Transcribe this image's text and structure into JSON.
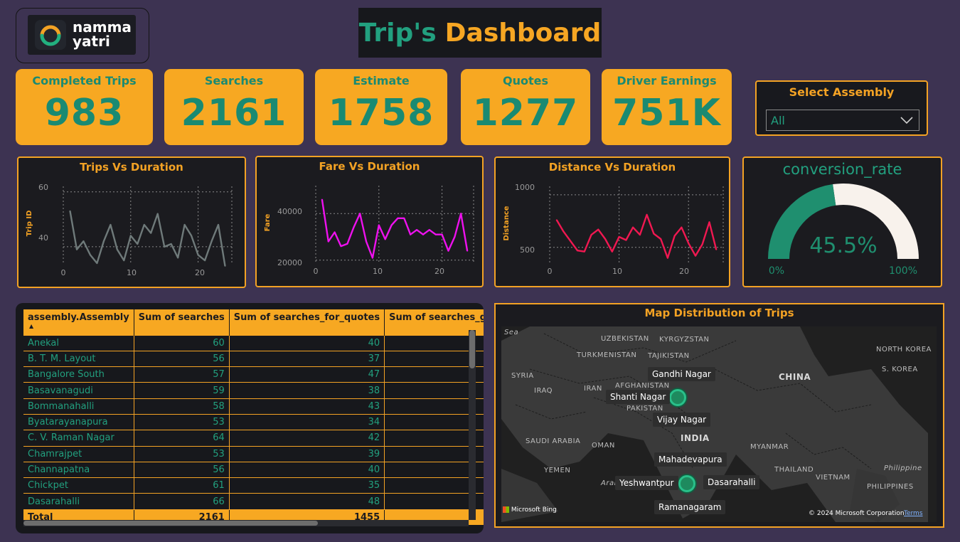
{
  "logo": {
    "line1": "namma",
    "line2": "yatri"
  },
  "title": {
    "part1": "Trip's",
    "part2": "Dashboard"
  },
  "kpis": [
    {
      "label": "Completed Trips",
      "value": "983"
    },
    {
      "label": "Searches",
      "value": "2161"
    },
    {
      "label": "Estimate",
      "value": "1758"
    },
    {
      "label": "Quotes",
      "value": "1277"
    },
    {
      "label": "Driver Earnings",
      "value": "751K"
    }
  ],
  "slicer": {
    "title": "Select Assembly",
    "selected": "All"
  },
  "charts": {
    "trips": {
      "title": "Trips Vs Duration",
      "ylabel": "Trip ID",
      "yticks": [
        "60",
        "40"
      ],
      "xticks": [
        "0",
        "10",
        "20"
      ]
    },
    "fare": {
      "title": "Fare Vs Duration",
      "ylabel": "Fare",
      "yticks": [
        "40000",
        "20000"
      ],
      "xticks": [
        "0",
        "10",
        "20"
      ]
    },
    "distance": {
      "title": "Distance Vs Duration",
      "ylabel": "Distance",
      "yticks": [
        "1000",
        "500"
      ],
      "xticks": [
        "0",
        "10",
        "20"
      ]
    }
  },
  "chart_data": [
    {
      "type": "line",
      "title": "Trips Vs Duration",
      "ylabel": "Trip ID",
      "xlim": [
        0,
        25
      ],
      "ylim": [
        34,
        62
      ],
      "color": "#6f7a7a",
      "x": [
        1,
        2,
        3,
        4,
        5,
        6,
        7,
        8,
        9,
        10,
        11,
        12,
        13,
        14,
        15,
        16,
        17,
        18,
        19,
        20,
        21,
        22,
        23,
        24
      ],
      "y": [
        53,
        39,
        42,
        37,
        34,
        42,
        48,
        39,
        35,
        44,
        41,
        48,
        45,
        52,
        40,
        41,
        36,
        48,
        44,
        37,
        35,
        42,
        48,
        33
      ]
    },
    {
      "type": "line",
      "title": "Fare Vs Duration",
      "ylabel": "Fare",
      "xlim": [
        0,
        25
      ],
      "ylim": [
        19000,
        52000
      ],
      "color": "#ee11ee",
      "x": [
        1,
        2,
        3,
        4,
        5,
        6,
        7,
        8,
        9,
        10,
        11,
        12,
        13,
        14,
        15,
        16,
        17,
        18,
        19,
        20,
        21,
        22,
        23,
        24
      ],
      "y": [
        46000,
        28000,
        32000,
        26000,
        27000,
        34000,
        40000,
        28000,
        21000,
        35000,
        29000,
        35000,
        38000,
        38000,
        31000,
        33000,
        31000,
        33000,
        31000,
        31000,
        24000,
        30000,
        40000,
        24000
      ]
    },
    {
      "type": "line",
      "title": "Distance Vs Duration",
      "ylabel": "Distance",
      "xlim": [
        0,
        25
      ],
      "ylim": [
        350,
        1080
      ],
      "color": "#f01851",
      "x": [
        1,
        2,
        3,
        4,
        5,
        6,
        7,
        8,
        9,
        10,
        11,
        12,
        13,
        14,
        15,
        16,
        17,
        18,
        19,
        20,
        21,
        22,
        23,
        24
      ],
      "y": [
        760,
        650,
        560,
        470,
        460,
        620,
        670,
        580,
        460,
        600,
        570,
        690,
        620,
        810,
        630,
        580,
        400,
        610,
        690,
        540,
        420,
        530,
        740,
        480
      ]
    }
  ],
  "gauge": {
    "title": "conversion_rate",
    "value": 45.5,
    "value_label": "45.5%",
    "min_label": "0%",
    "max_label": "100%",
    "fill_color": "#1f8f6f",
    "track_color": "#f8f2ec"
  },
  "table": {
    "headers": [
      "assembly.Assembly",
      "Sum of searches",
      "Sum of searches_for_quotes",
      "Sum of searches_got_est"
    ],
    "rows": [
      [
        "Anekal",
        "60",
        "40"
      ],
      [
        "B. T. M. Layout",
        "56",
        "37"
      ],
      [
        "Bangalore South",
        "57",
        "47"
      ],
      [
        "Basavanagudi",
        "59",
        "38"
      ],
      [
        "Bommanahalli",
        "58",
        "43"
      ],
      [
        "Byatarayanapura",
        "53",
        "34"
      ],
      [
        "C. V. Raman Nagar",
        "64",
        "42"
      ],
      [
        "Chamrajpet",
        "53",
        "39"
      ],
      [
        "Channapatna",
        "56",
        "40"
      ],
      [
        "Chickpet",
        "61",
        "35"
      ],
      [
        "Dasarahalli",
        "66",
        "48"
      ]
    ],
    "total": [
      "Total",
      "2161",
      "1455"
    ]
  },
  "map": {
    "title": "Map Distribution of Trips",
    "places": [
      "Gandhi Nagar",
      "Shanti Nagar",
      "Vijay Nagar",
      "Mahadevapura",
      "Yeshwantpur",
      "Dasarahalli",
      "Ramanagaram"
    ],
    "geo": [
      "Sea",
      "UZBEKISTAN",
      "KYRGYZSTAN",
      "TURKMENISTAN",
      "TAJIKISTAN",
      "SYRIA",
      "AFGHANISTAN",
      "IRAQ",
      "IRAN",
      "PAKISTAN",
      "CHINA",
      "NORTH KOREA",
      "S. KOREA",
      "INDIA",
      "SAUDI ARABIA",
      "OMAN",
      "MYANMAR",
      "YEMEN",
      "THAILAND",
      "VIETNAM",
      "Philippine",
      "PHILIPPINES",
      "Arab"
    ],
    "attribution": "Microsoft Bing",
    "copyright": "© 2024 Microsoft Corporation",
    "terms": "Terms"
  }
}
